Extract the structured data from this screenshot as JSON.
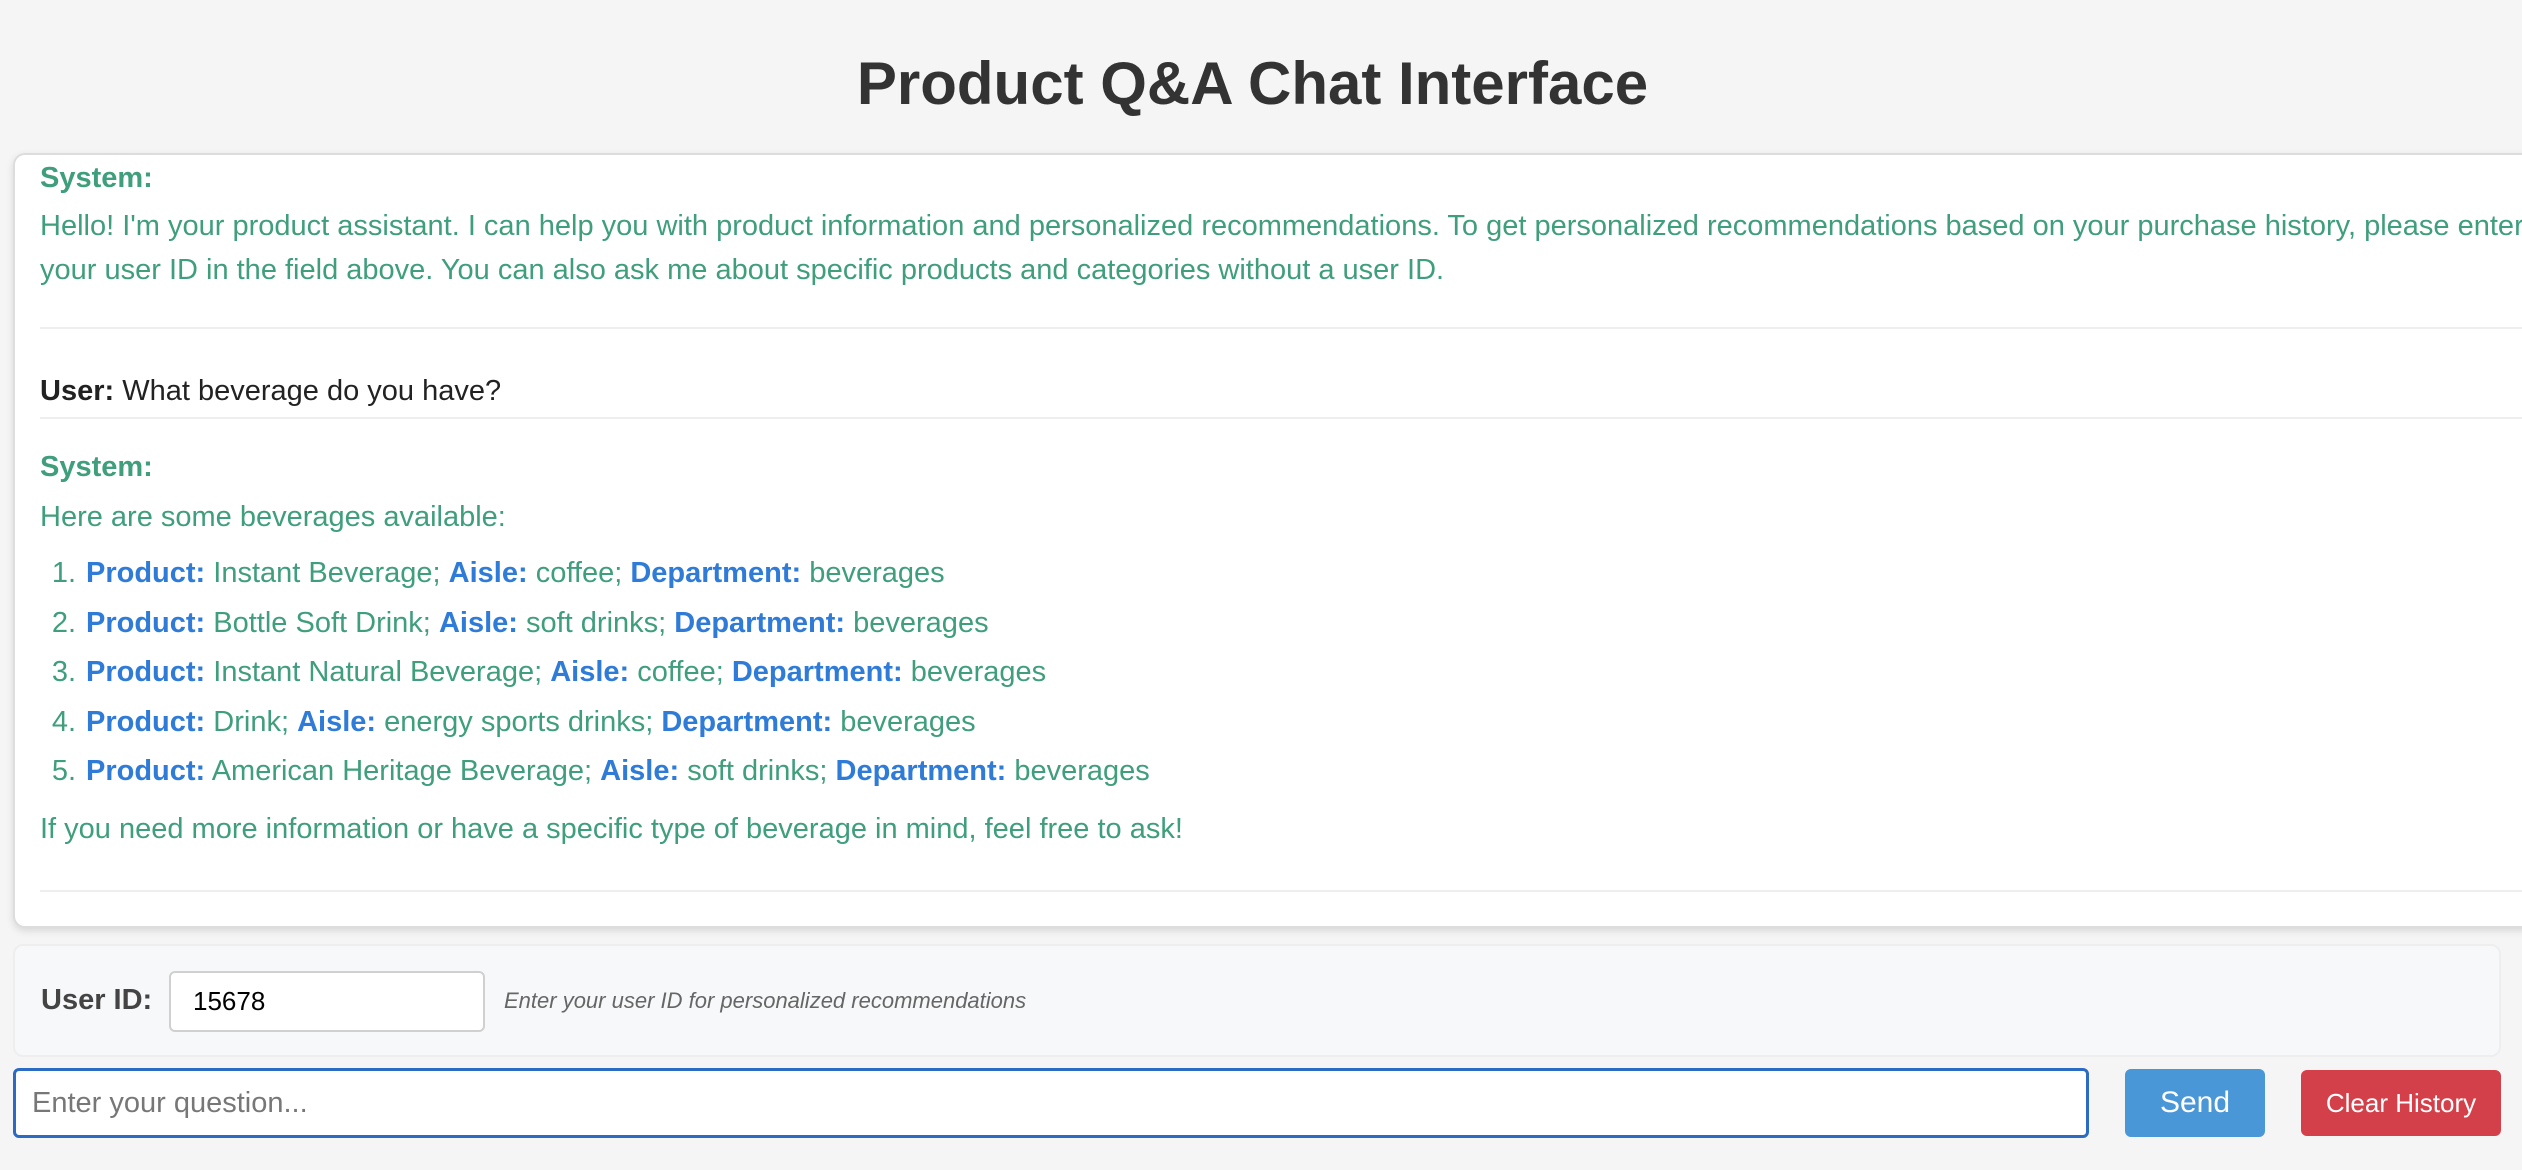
{
  "header": {
    "title": "Product Q&A Chat Interface"
  },
  "chat": {
    "messages": [
      {
        "role_label": "System:",
        "text": "Hello! I'm your product assistant. I can help you with product information and personalized recommendations. To get personalized recommendations based on your purchase history, please enter your user ID in the field above. You can also ask me about specific products and categories without a user ID."
      },
      {
        "role_label": "User:",
        "text": "What beverage do you have?"
      },
      {
        "role_label": "System:",
        "intro": "Here are some beverages available:",
        "labels": {
          "product": "Product:",
          "aisle": "Aisle:",
          "department": "Department:"
        },
        "products": [
          {
            "num": "1.",
            "product": "Instant Beverage;",
            "aisle": "coffee;",
            "department": "beverages"
          },
          {
            "num": "2.",
            "product": "Bottle Soft Drink;",
            "aisle": "soft drinks;",
            "department": "beverages"
          },
          {
            "num": "3.",
            "product": "Instant Natural Beverage;",
            "aisle": "coffee;",
            "department": "beverages"
          },
          {
            "num": "4.",
            "product": "Drink;",
            "aisle": "energy sports drinks;",
            "department": "beverages"
          },
          {
            "num": "5.",
            "product": "American Heritage Beverage;",
            "aisle": "soft drinks;",
            "department": "beverages"
          }
        ],
        "outro": "If you need more information or have a specific type of beverage in mind, feel free to ask!"
      }
    ]
  },
  "user_id": {
    "label": "User ID:",
    "value": "15678",
    "hint": "Enter your user ID for personalized recommendations"
  },
  "composer": {
    "placeholder": "Enter your question...",
    "send_label": "Send",
    "clear_label": "Clear History"
  },
  "colors": {
    "system_text": "#3f9e7b",
    "keyword": "#2f7bd8",
    "send_button": "#4a97d8",
    "clear_button": "#d4404a",
    "input_focus_border": "#2c6bc4"
  }
}
